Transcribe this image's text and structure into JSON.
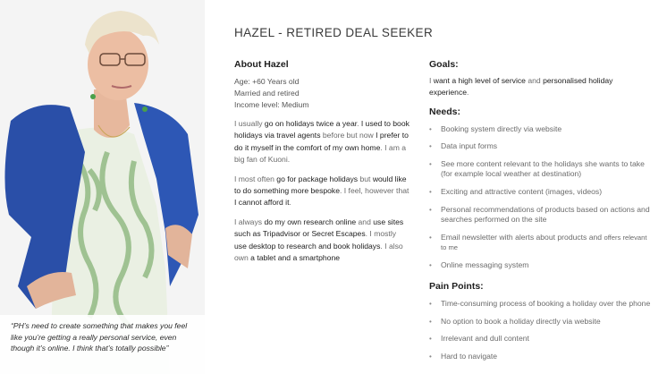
{
  "persona": {
    "title": "HAZEL - RETIRED DEAL SEEKER",
    "quote": "“PH’s need to create something that makes you feel like you’re getting a really personal service, even though it’s online. I think that’s totally possible”"
  },
  "about": {
    "heading": "About Hazel",
    "age": "Age: +60 Years old",
    "status": "Married and retired",
    "income": "Income level: Medium",
    "p1": [
      "I usually ",
      "go on holidays twice a year",
      ". ",
      "I used to book holidays via travel agents",
      " before but now ",
      "I prefer to do it myself in the comfort of my own home",
      ". I am a big fan of Kuoni."
    ],
    "p2": [
      "I most often ",
      "go for package holidays",
      " but ",
      "would like to do something more bespoke",
      ". I feel, however that ",
      "I cannot afford it",
      "."
    ],
    "p3": [
      "I always ",
      "do my own research online",
      " and ",
      "use sites such as Tripadvisor or Secret Escapes",
      ". I mostly ",
      "use desktop to research and book holidays",
      ". I also own ",
      "a tablet and a smartphone"
    ]
  },
  "goals": {
    "heading": "Goals:",
    "text": [
      "I ",
      "want a high level of service",
      " and ",
      "personalised holiday experience",
      "."
    ]
  },
  "needs": {
    "heading": "Needs:",
    "items": [
      "Booking system directly via website",
      "Data input forms",
      "See more content relevant to the holidays she wants to take (for example local weather at destination)",
      "Exciting and attractive content (images, videos)",
      "Personal recommendations of products based on actions and searches performed on the site",
      "Email newsletter with alerts about products and ",
      "offers relevant to me",
      "Online messaging system"
    ]
  },
  "pain": {
    "heading": "Pain Points:",
    "items": [
      "Time-consuming process of booking a holiday over the phone",
      "No option to book a holiday directly via website",
      "Irrelevant and dull content",
      "Hard to navigate"
    ]
  }
}
